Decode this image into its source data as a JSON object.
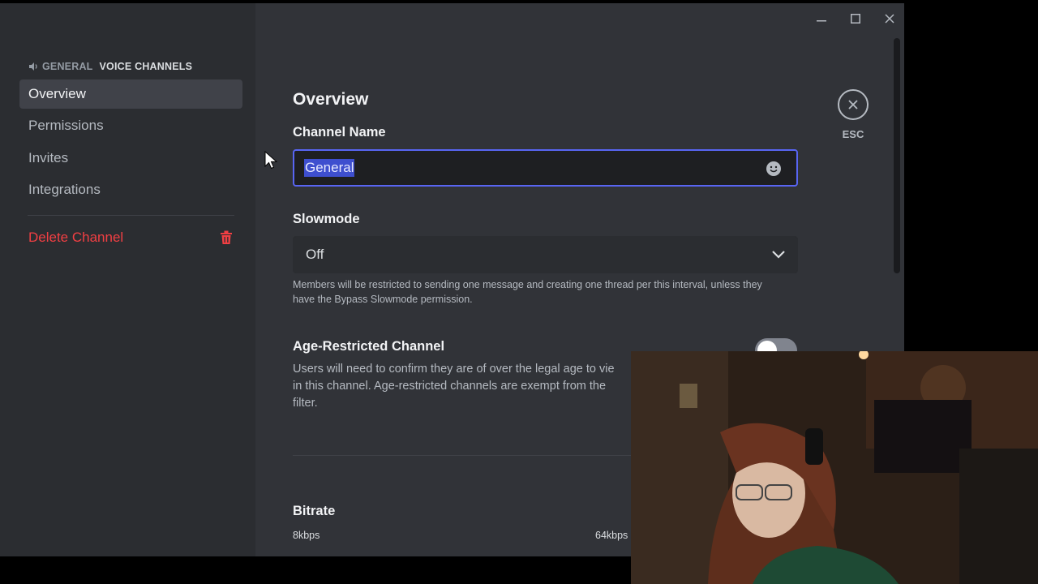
{
  "sidebar": {
    "header_channel": "GENERAL",
    "header_category": "VOICE CHANNELS",
    "items": [
      {
        "label": "Overview",
        "active": true
      },
      {
        "label": "Permissions"
      },
      {
        "label": "Invites"
      },
      {
        "label": "Integrations"
      }
    ],
    "delete_label": "Delete Channel"
  },
  "main": {
    "title": "Overview",
    "channel_name_label": "Channel Name",
    "channel_name_value": "General",
    "slowmode_label": "Slowmode",
    "slowmode_value": "Off",
    "slowmode_help": "Members will be restricted to sending one message and creating one thread per this interval, unless they have the Bypass Slowmode permission.",
    "age_label": "Age-Restricted Channel",
    "age_desc_1": "Users will need to confirm they are of over the legal age to vie",
    "age_desc_2": "in this channel. Age-restricted channels are exempt from the",
    "age_desc_3": "filter.",
    "age_restricted_on": false,
    "bitrate_label": "Bitrate",
    "bitrate_min": "8kbps",
    "bitrate_max": "64kbps"
  },
  "close": {
    "esc_label": "ESC"
  },
  "colors": {
    "accent": "#5865f2",
    "danger": "#f23f43",
    "bg": "#313338",
    "sidebar": "#2b2d31"
  }
}
